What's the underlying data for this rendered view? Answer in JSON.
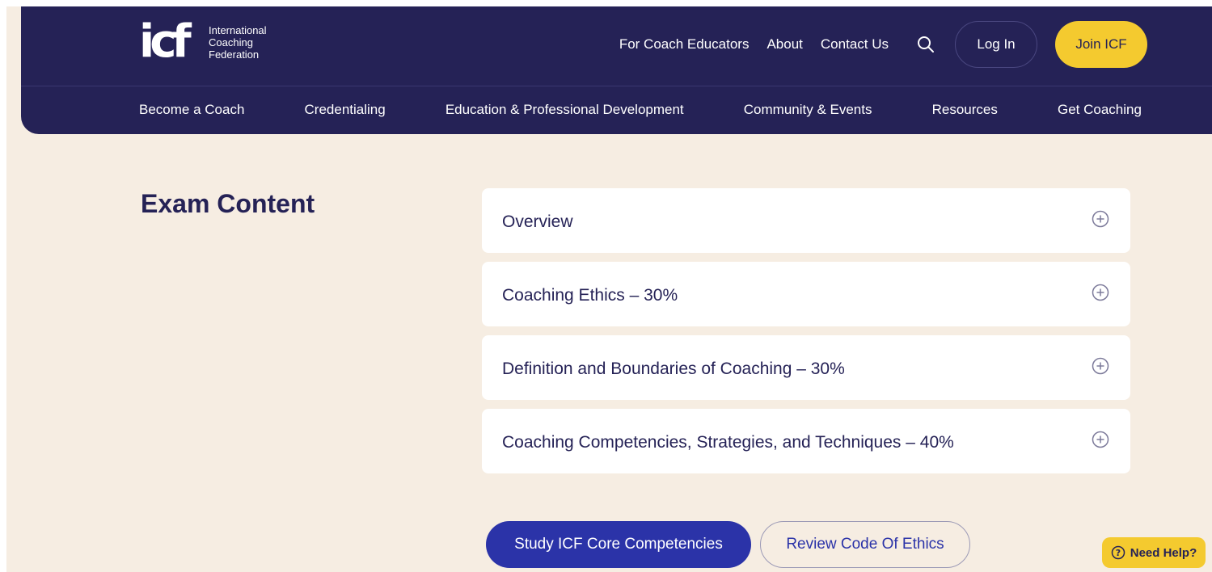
{
  "header": {
    "logo_mark": "icf",
    "logo_text": [
      "International",
      "Coaching",
      "Federation"
    ],
    "top_links": [
      "For Coach Educators",
      "About",
      "Contact Us"
    ],
    "login_label": "Log In",
    "join_label": "Join ICF",
    "main_nav": [
      "Become a Coach",
      "Credentialing",
      "Education & Professional Development",
      "Community & Events",
      "Resources",
      "Get Coaching"
    ]
  },
  "main": {
    "title": "Exam Content",
    "accordion": [
      {
        "label": "Overview",
        "icon": "plus-circle-icon"
      },
      {
        "label": "Coaching Ethics – 30%",
        "icon": "plus-circle-icon"
      },
      {
        "label": "Definition and Boundaries of Coaching – 30%",
        "icon": "plus-circle-icon"
      },
      {
        "label": "Coaching Competencies, Strategies, and Techniques – 40%",
        "icon": "plus-circle-icon"
      }
    ],
    "primary_button": "Study ICF Core Competencies",
    "secondary_button": "Review Code Of Ethics"
  },
  "help": {
    "label": "Need Help?",
    "icon": "question-circle-icon"
  },
  "colors": {
    "navy": "#252256",
    "yellow": "#f4ca2f",
    "background": "#f6ede2",
    "button_blue": "#2b33a8"
  }
}
